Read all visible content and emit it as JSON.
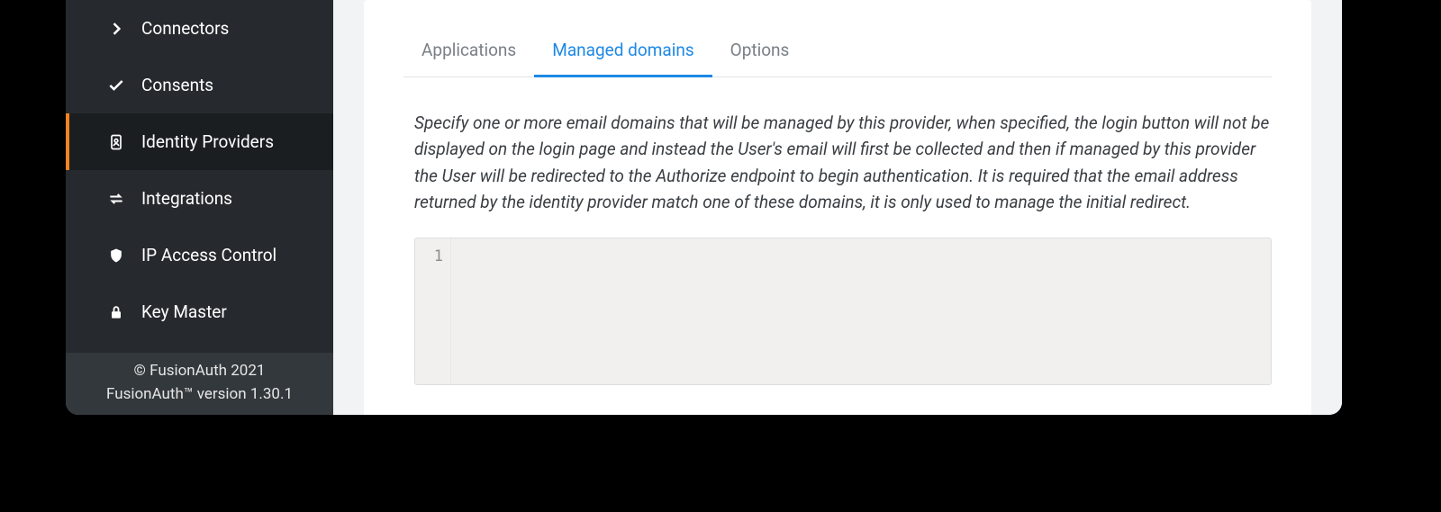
{
  "sidebar": {
    "items": [
      {
        "label": "Connectors",
        "icon": "chevron-right-icon",
        "active": false
      },
      {
        "label": "Consents",
        "icon": "check-icon",
        "active": false
      },
      {
        "label": "Identity Providers",
        "icon": "badge-icon",
        "active": true
      },
      {
        "label": "Integrations",
        "icon": "arrows-icon",
        "active": false
      },
      {
        "label": "IP Access Control",
        "icon": "shield-icon",
        "active": false
      },
      {
        "label": "Key Master",
        "icon": "lock-icon",
        "active": false
      }
    ]
  },
  "footer": {
    "copyright": "© FusionAuth 2021",
    "version": "FusionAuth™ version 1.30.1"
  },
  "tabs": [
    {
      "label": "Applications",
      "active": false
    },
    {
      "label": "Managed domains",
      "active": true
    },
    {
      "label": "Options",
      "active": false
    }
  ],
  "description": "Specify one or more email domains that will be managed by this provider, when specified, the login button will not be displayed on the login page and instead the User's email will first be collected and then if managed by this provider the User will be redirected to the Authorize endpoint to begin authentication. It is required that the email address returned by the identity provider match one of these domains, it is only used to manage the initial redirect.",
  "editor": {
    "line_number": "1",
    "content": ""
  },
  "colors": {
    "accent_orange": "#f58320",
    "accent_blue": "#1e88e5",
    "sidebar_bg": "#262a2e",
    "sidebar_active_bg": "#1b1e21"
  }
}
